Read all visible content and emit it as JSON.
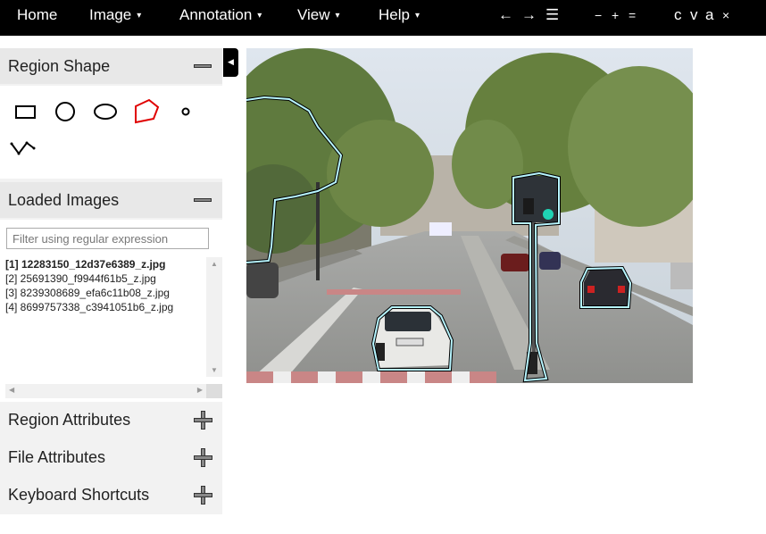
{
  "menubar": {
    "items": [
      {
        "label": "Home",
        "has_menu": false
      },
      {
        "label": "Image",
        "has_menu": true
      },
      {
        "label": "Annotation",
        "has_menu": true
      },
      {
        "label": "View",
        "has_menu": true
      },
      {
        "label": "Help",
        "has_menu": true
      }
    ],
    "caret": "▾",
    "tools": {
      "prev": "←",
      "next": "→",
      "list": "☰",
      "zoom_out": "−",
      "zoom_in": "+",
      "zoom_reset": "=",
      "copy": "c",
      "paste": "v",
      "select_all": "a",
      "delete": "×"
    }
  },
  "left_panel": {
    "region_shape": {
      "title": "Region Shape",
      "shapes": [
        "rectangle",
        "circle",
        "ellipse",
        "polygon",
        "point",
        "polyline"
      ],
      "selected": "polygon"
    },
    "loaded_images": {
      "title": "Loaded Images",
      "filter_placeholder": "Filter using regular expression",
      "items": [
        {
          "label": "[1] 12283150_12d37e6389_z.jpg",
          "selected": true
        },
        {
          "label": "[2] 25691390_f9944f61b5_z.jpg",
          "selected": false
        },
        {
          "label": "[3] 8239308689_efa6c11b08_z.jpg",
          "selected": false
        },
        {
          "label": "[4] 8699757338_c3941051b6_z.jpg",
          "selected": false
        }
      ]
    },
    "region_attributes": {
      "title": "Region Attributes"
    },
    "file_attributes": {
      "title": "File Attributes"
    },
    "keyboard_shortcuts": {
      "title": "Keyboard Shortcuts"
    }
  },
  "colors": {
    "menubar_bg": "#000000",
    "panel_bg": "#f2f2f2",
    "selected_shape": "#e00000",
    "region_outline": "#b7f5ff"
  }
}
